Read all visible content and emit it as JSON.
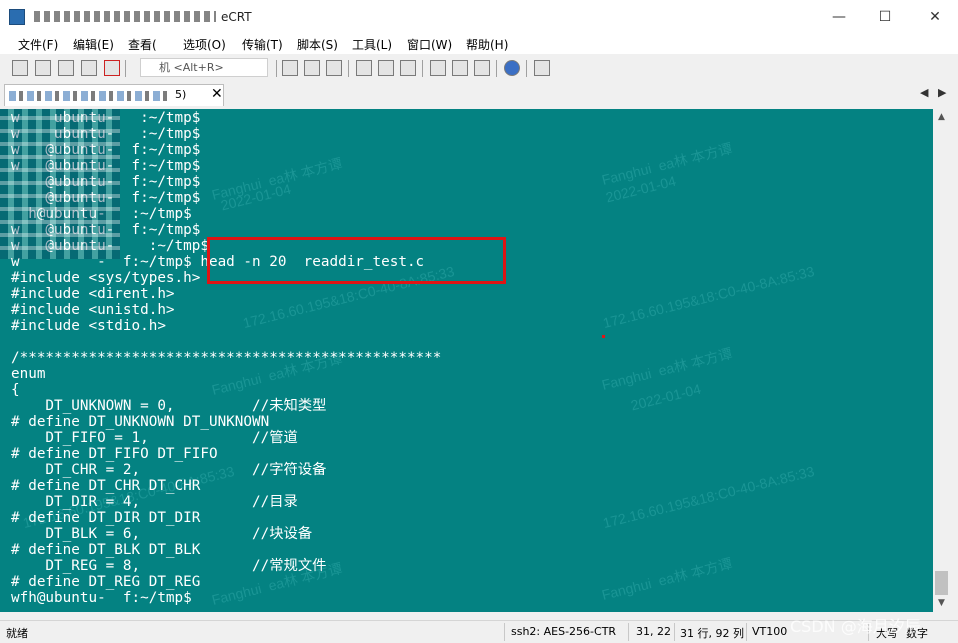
{
  "window": {
    "title": "eCRT",
    "minimize": "—",
    "maximize": "☐",
    "close": "✕"
  },
  "menu": [
    "文件(F)",
    "编辑(E)",
    "查看(",
    "选项(O)",
    "传输(T)",
    "脚本(S)",
    "工具(L)",
    "窗口(W)",
    "帮助(H)"
  ],
  "toolbar": {
    "quick_connect_placeholder": "机 <Alt+R>"
  },
  "tab": {
    "label": "5)",
    "close": "✕",
    "nav_left": "◀",
    "nav_right": "▶"
  },
  "terminal": {
    "lines": [
      "w    ubuntu-   :~/tmp$",
      "w    ubuntu-   :~/tmp$",
      "w   @ubuntu-  f:~/tmp$",
      "w   @ubuntu-  f:~/tmp$",
      "    @ubuntu-  f:~/tmp$",
      "    @ubuntu-  f:~/tmp$",
      "  h@ubuntu-   :~/tmp$",
      "w   @ubuntu-  f:~/tmp$",
      "w   @ubuntu-    :~/tmp$",
      "w         -  f:~/tmp$ head -n 20  readdir_test.c",
      "#include <sys/types.h>",
      "#include <dirent.h>",
      "#include <unistd.h>",
      "#include <stdio.h>",
      "",
      "/*************************************************",
      "enum",
      "{",
      "    DT_UNKNOWN = 0,         //未知类型",
      "# define DT_UNKNOWN DT_UNKNOWN",
      "    DT_FIFO = 1,            //管道",
      "# define DT_FIFO DT_FIFO",
      "    DT_CHR = 2,             //字符设备",
      "# define DT_CHR DT_CHR",
      "    DT_DIR = 4,             //目录",
      "# define DT_DIR DT_DIR",
      "    DT_BLK = 6,             //块设备",
      "# define DT_BLK DT_BLK",
      "    DT_REG = 8,             //常规文件",
      "# define DT_REG DT_REG",
      "wfh@ubuntu-  f:~/tmp$"
    ],
    "watermarks": [
      "Fanghui  ea林 本方谭",
      "2022-01-04",
      "172.16.60.195&18:C0-40-8A:85:33"
    ]
  },
  "statusbar": {
    "ready": "就绪",
    "cipher": "ssh2: AES-256-CTR",
    "cursor": "31,  22",
    "rows_cols": "31 行, 92 列",
    "terminal_type": "VT100",
    "caps": "大写",
    "num": "数字"
  },
  "overlay": {
    "csdn": "CSDN @海月汐辰"
  },
  "colors": {
    "terminal_bg": "#048282",
    "terminal_fg": "#ffffff",
    "highlight": "#e01515"
  }
}
